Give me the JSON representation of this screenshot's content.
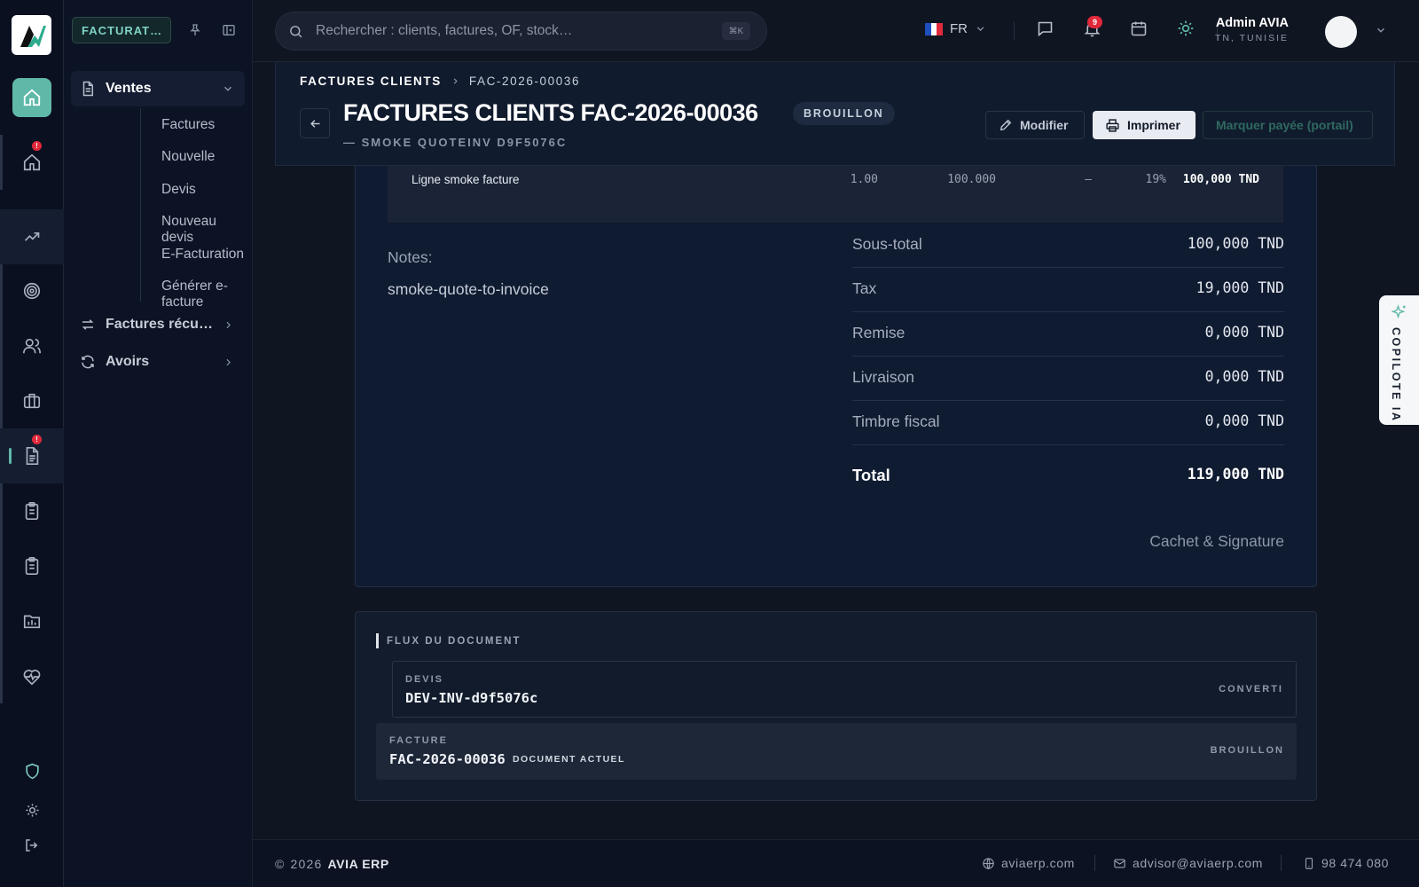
{
  "app": {
    "module_badge": "FACTURAT…",
    "colors": {
      "accent": "#5fb8a8",
      "background": "#0f1521",
      "danger": "#e0293a"
    }
  },
  "rail": {
    "items": [
      {
        "name": "home",
        "icon": "home-icon"
      },
      {
        "name": "home-alert",
        "icon": "home-icon",
        "badge": "!"
      },
      {
        "name": "sales",
        "icon": "trending-up-icon"
      },
      {
        "name": "targets",
        "icon": "target-icon"
      },
      {
        "name": "users",
        "icon": "users-icon"
      },
      {
        "name": "briefcase",
        "icon": "briefcase-icon"
      },
      {
        "name": "invoices",
        "icon": "document-icon",
        "badge": "!"
      },
      {
        "name": "clipboard",
        "icon": "clipboard-icon"
      },
      {
        "name": "clipboard-2",
        "icon": "clipboard-icon"
      },
      {
        "name": "reports",
        "icon": "folder-chart-icon"
      },
      {
        "name": "health",
        "icon": "heart-pulse-icon"
      },
      {
        "name": "security",
        "icon": "shield-icon"
      },
      {
        "name": "theme",
        "icon": "sun-icon"
      },
      {
        "name": "logout",
        "icon": "logout-icon"
      }
    ],
    "badge_text": "!"
  },
  "sidebar": {
    "groups": [
      {
        "label": "Ventes",
        "icon": "document-icon"
      },
      {
        "label": "Factures récu…",
        "icon": "arrows-icon"
      },
      {
        "label": "Avoirs",
        "icon": "refresh-icon"
      }
    ],
    "sub_items": [
      "Factures",
      "Nouvelle",
      "Devis",
      "Nouveau devis",
      "E-Facturation",
      "Générer e-facture"
    ]
  },
  "topbar": {
    "search_placeholder": "Rechercher : clients, factures, OF, stock…",
    "search_shortcut": "⌘K",
    "language": "FR",
    "notifications_count": "9",
    "user_name": "Admin AVIA",
    "user_location": "TN, TUNISIE"
  },
  "header": {
    "breadcrumb_root": "FACTURES CLIENTS",
    "breadcrumb_current": "FAC-2026-00036",
    "title": "FACTURES CLIENTS FAC-2026-00036",
    "status": "BROUILLON",
    "subtitle": "— SMOKE QUOTEINV D9F5076C",
    "actions": {
      "edit": "Modifier",
      "print": "Imprimer",
      "mark_paid": "Marquer payée (portail)"
    }
  },
  "invoice": {
    "line": {
      "description": "Ligne smoke facture",
      "quantity": "1.00",
      "unit_price": "100.000",
      "discount": "—",
      "tax_rate": "19%",
      "total": "100,000 TND"
    },
    "notes_label": "Notes:",
    "notes": "smoke-quote-to-invoice",
    "totals": [
      {
        "label": "Sous-total",
        "value": "100,000 TND"
      },
      {
        "label": "Tax",
        "value": "19,000 TND"
      },
      {
        "label": "Remise",
        "value": "0,000 TND"
      },
      {
        "label": "Livraison",
        "value": "0,000 TND"
      },
      {
        "label": "Timbre fiscal",
        "value": "0,000 TND"
      }
    ],
    "grand_total": {
      "label": "Total",
      "value": "119,000 TND"
    },
    "signature_label": "Cachet & Signature"
  },
  "flux": {
    "title": "FLUX DU DOCUMENT",
    "items": [
      {
        "type": "DEVIS",
        "ref": "DEV-INV-d9f5076c",
        "status": "CONVERTI"
      },
      {
        "type": "FACTURE",
        "ref": "FAC-2026-00036",
        "tag": "DOCUMENT ACTUEL",
        "status": "BROUILLON"
      }
    ]
  },
  "footer": {
    "copyright": "2026",
    "brand": "AVIA ERP",
    "website": "aviaerp.com",
    "email": "advisor@aviaerp.com",
    "phone": "98 474 080"
  },
  "copilot": {
    "label": "COPILOTE IA"
  }
}
